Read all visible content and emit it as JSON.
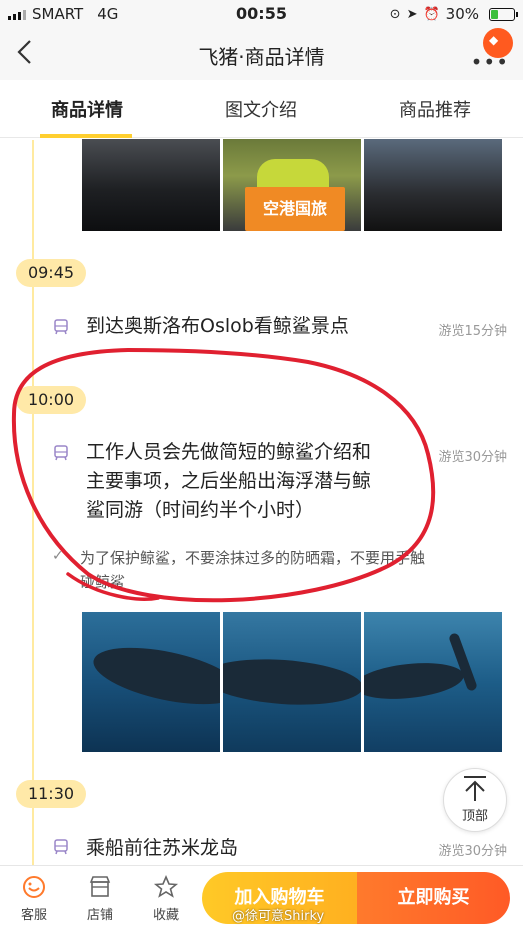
{
  "status_bar": {
    "carrier": "SMART",
    "network": "4G",
    "time": "00:55",
    "battery": "30%",
    "battery_level": 0.3
  },
  "nav": {
    "title": "飞猪·商品详情",
    "back_icon": "chevron-left-icon",
    "more_icon": "more-dots-icon"
  },
  "tabs": [
    {
      "label": "商品详情",
      "active": true
    },
    {
      "label": "图文介绍",
      "active": false
    },
    {
      "label": "商品推荐",
      "active": false
    }
  ],
  "photo1": {
    "sign_text": "空港国旅"
  },
  "schedule": [
    {
      "time": "09:45",
      "text": "到达奥斯洛布Oslob看鲸鲨景点",
      "duration": "游览15分钟"
    },
    {
      "time": "10:00",
      "text_lines": [
        "工作人员会先做简短的鲸鲨介绍和",
        "主要事项，之后坐船出海浮潜与鲸",
        "鲨同游（时间约半个小时）"
      ],
      "duration": "游览30分钟",
      "note_lines": [
        "为了保护鲸鲨，不要涂抹过多的防晒霜，不要用手触",
        "碰鲸鲨"
      ]
    },
    {
      "time": "11:30",
      "text": "乘船前往苏米龙岛",
      "duration": "游览30分钟"
    }
  ],
  "top_button": {
    "label": "顶部"
  },
  "bottom_bar": {
    "service": "客服",
    "store": "店铺",
    "favorite": "收藏",
    "add_to_cart": "加入购物车",
    "buy_now": "立即购买"
  },
  "watermark": "@徐可意Shirky",
  "colors": {
    "accent": "#ffcf2f",
    "badge": "#ffe9a8",
    "cart": "#ffc927",
    "buy": "#ff5a26",
    "annotation": "#e02030"
  }
}
